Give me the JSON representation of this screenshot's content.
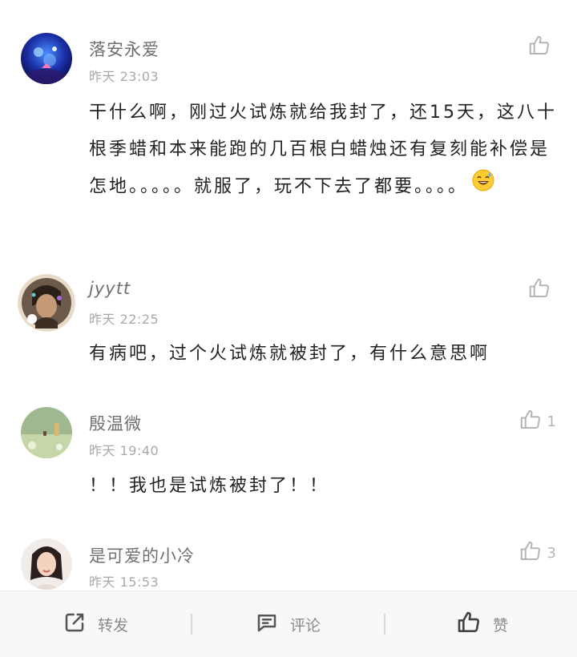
{
  "comments": [
    {
      "username": "落安永爱",
      "time": "昨天 23:03",
      "text": "干什么啊，刚过火试炼就给我封了，还15天，这八十根季蜡和本来能跑的几百根白蜡烛还有复刻能补偿是怎地。。。。。就服了，玩不下去了都要。。。。",
      "emoji": "sweat-smile-emoji",
      "like_count": ""
    },
    {
      "username": "jyytt",
      "time": "昨天 22:25",
      "text": "有病吧，过个火试炼就被封了，有什么意思啊",
      "like_count": ""
    },
    {
      "username": "殷温微",
      "time": "昨天 19:40",
      "text": "！！我也是试炼被封了！！",
      "like_count": "1"
    },
    {
      "username": "是可爱的小冷",
      "time": "昨天 15:53",
      "text": "",
      "like_count": "3"
    }
  ],
  "bottom_bar": {
    "repost": "转发",
    "comment": "评论",
    "like": "赞"
  },
  "icons": {
    "like": "thumbs-up-icon",
    "repost": "repost-icon",
    "comment": "comment-icon"
  },
  "colors": {
    "text": "#222222",
    "username": "#6f6f6f",
    "meta": "#a9a9a9",
    "icon": "#b5b5b5",
    "bar_bg": "#f8f8f8"
  }
}
